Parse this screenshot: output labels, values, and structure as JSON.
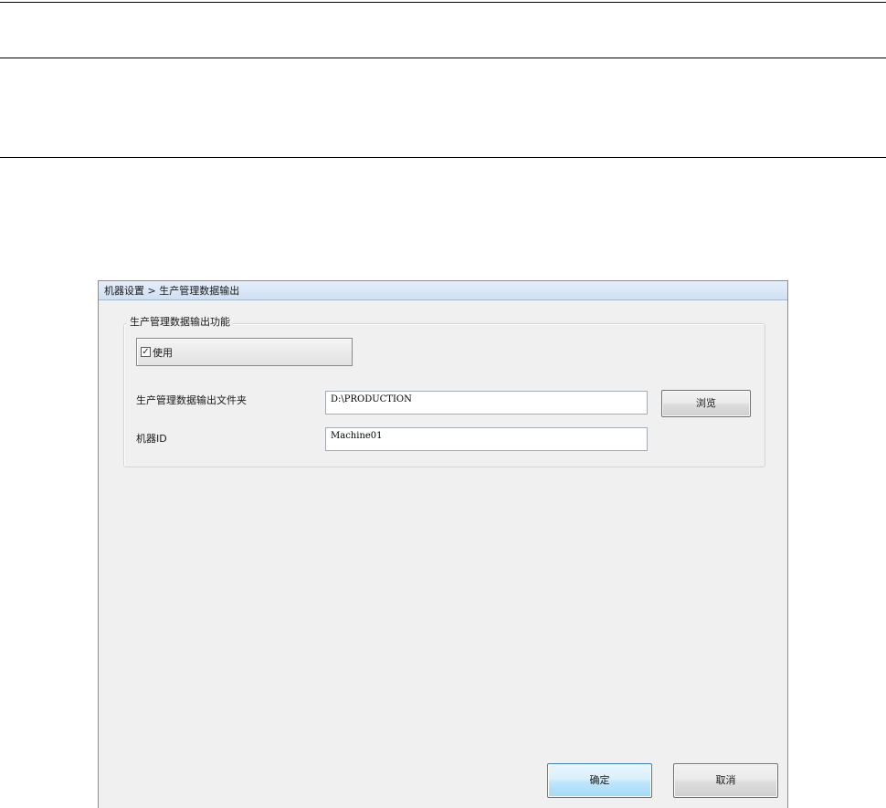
{
  "window": {
    "title": "机器设置 > 生产管理数据输出"
  },
  "group": {
    "legend": "生产管理数据输出功能",
    "enable_toggle": {
      "label": "使用",
      "checked": true,
      "check_mark": "✓"
    }
  },
  "fields": {
    "output_folder": {
      "label": "生产管理数据输出文件夹",
      "value": "D:\\PRODUCTION"
    },
    "machine_id": {
      "label": "机器ID",
      "value": "Machine01"
    }
  },
  "buttons": {
    "browse": "浏览",
    "ok": "确定",
    "cancel": "取消"
  },
  "colors": {
    "window_bg": "#f0f0f0",
    "titlebar": "#d8e6f5",
    "default_button": "#bee6fd"
  }
}
